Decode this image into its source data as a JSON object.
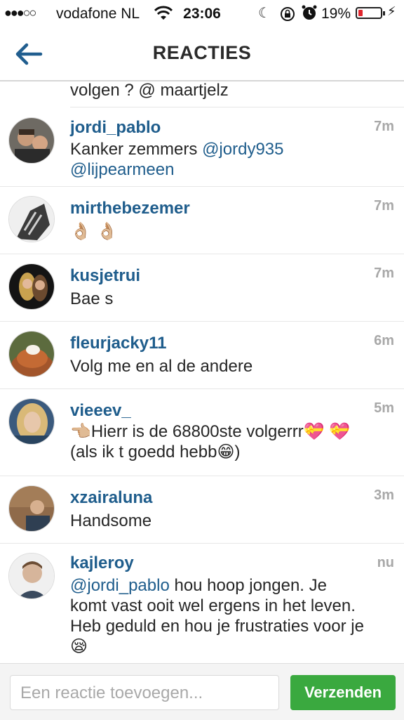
{
  "status": {
    "carrier": "vodafone NL",
    "time": "23:06",
    "battery": "19%",
    "battery_level": 0.19
  },
  "nav": {
    "title": "REACTIES"
  },
  "partial_comment": {
    "text": "volgen ? @ maartjelz"
  },
  "comments": [
    {
      "user": "jordi_pablo",
      "time": "7m",
      "text_1": "Kanker zemmers ",
      "mention_1": "@jordy935",
      "mention_2": "@lijpearmeen"
    },
    {
      "user": "mirthebezemer",
      "time": "7m",
      "emoji": "👌🏼 👌🏼"
    },
    {
      "user": "kusjetrui",
      "time": "7m",
      "text": "Bae s"
    },
    {
      "user": "fleurjacky11",
      "time": "6m",
      "text": "Volg me en al de andere"
    },
    {
      "user": "vieeev_",
      "time": "5m",
      "line_1": "👈🏼Hierr is de 68800ste volgerrr💝 💝",
      "line_2": "(als ik t goedd hebb😁)"
    },
    {
      "user": "xzairaluna",
      "time": "3m",
      "text": "Handsome"
    },
    {
      "user": "kajleroy",
      "time": "nu",
      "mention": "@jordi_pablo",
      "text_1": " hou hoop jongen. Je",
      "text_2": "komt vast ooit wel ergens in het leven.",
      "text_3": "Heb geduld en hou je frustraties voor je",
      "emoji": "😪"
    }
  ],
  "input": {
    "placeholder": "Een reactie toevoegen..."
  },
  "send_button": {
    "label": "Verzenden"
  },
  "colors": {
    "username": "#1f5d8c",
    "send": "#3aa93f",
    "battery_low": "#e0262e"
  }
}
